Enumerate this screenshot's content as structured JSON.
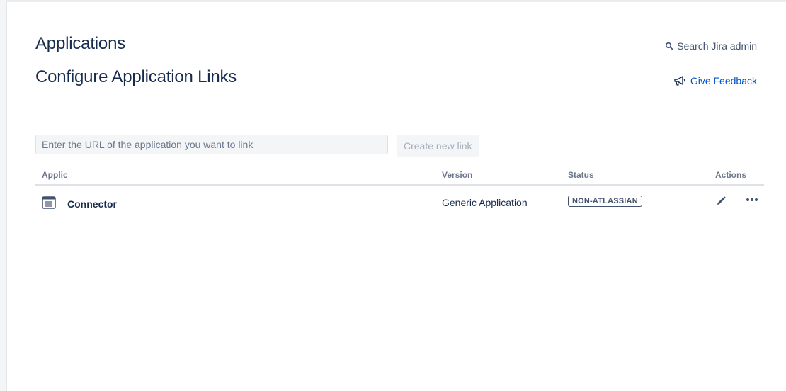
{
  "header": {
    "title": "Applications",
    "search_label": "Search Jira admin"
  },
  "section": {
    "title": "Configure Application Links",
    "feedback_label": "Give Feedback"
  },
  "link_form": {
    "url_placeholder": "Enter the URL of the application you want to link",
    "url_value": "",
    "create_label": "Create new link"
  },
  "table": {
    "columns": {
      "application": "Application",
      "version": "Version",
      "status": "Status",
      "actions": "Actions"
    },
    "rows": [
      {
        "name": "Connector",
        "icon": "application-icon",
        "version": "Generic Application",
        "status": "NON-ATLASSIAN"
      }
    ]
  },
  "icons": {
    "search": "search-icon",
    "feedback": "megaphone-icon",
    "edit": "pencil-icon",
    "more": "more-horizontal-icon"
  },
  "colors": {
    "text": "#172b4d",
    "link": "#0052cc",
    "muted": "#6b778c",
    "disabled": "#a5adba"
  }
}
